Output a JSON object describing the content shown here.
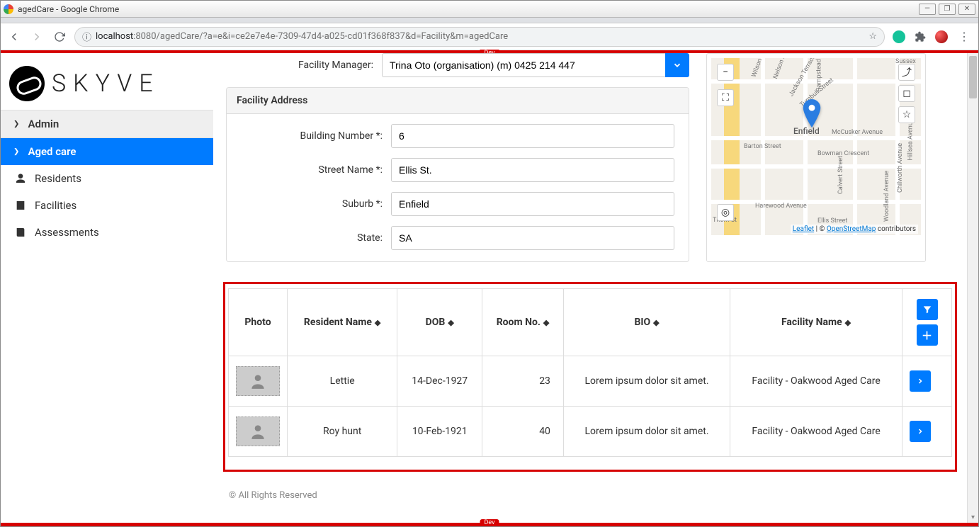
{
  "window": {
    "title": "agedCare - Google Chrome"
  },
  "url": {
    "host": "localhost",
    "port": ":8080",
    "path": "/agedCare/?a=e&i=ce2e7e4e-7309-47d4-a025-cd01f368f837&d=Facility&m=agedCare"
  },
  "dev_tag": "Dev",
  "logo_text": "SKYVE",
  "nav": {
    "admin": "Admin",
    "agedcare": "Aged care",
    "residents": "Residents",
    "facilities": "Facilities",
    "assessments": "Assessments"
  },
  "form": {
    "manager_label": "Facility Manager:",
    "manager_value": "Trina Oto (organisation) (m) 0425 214 447",
    "fieldset_title": "Facility Address",
    "building_label": "Building Number *:",
    "building_value": "6",
    "street_label": "Street Name *:",
    "street_value": "Ellis St.",
    "suburb_label": "Suburb *:",
    "suburb_value": "Enfield",
    "state_label": "State:",
    "state_value": "SA"
  },
  "map": {
    "place": "Enfield",
    "attribution_leaflet": "Leaflet",
    "attribution_osm": "OpenStreetMap",
    "attribution_suffix": " contributors",
    "roads": [
      "Wilson St",
      "Thorn St",
      "Hampstead Road",
      "Nelson St",
      "Jackson Terrace",
      "Turnbull Street",
      "Barton Street",
      "McCusker Avenue",
      "Bowman Crescent",
      "Harewood Avenue",
      "Hillsea Avenue",
      "Chilworth Avenue",
      "Woodland Avenue",
      "Ellis Street",
      "Calvert Street",
      "Sussex"
    ]
  },
  "table": {
    "headers": {
      "photo": "Photo",
      "name": "Resident Name",
      "dob": "DOB",
      "room": "Room No.",
      "bio": "BIO",
      "facility": "Facility Name"
    },
    "rows": [
      {
        "name": "Lettie",
        "dob": "14-Dec-1927",
        "room": "23",
        "bio": "Lorem ipsum dolor sit amet.",
        "facility": "Facility - Oakwood Aged Care"
      },
      {
        "name": "Roy hunt",
        "dob": "10-Feb-1921",
        "room": "40",
        "bio": "Lorem ipsum dolor sit amet.",
        "facility": "Facility - Oakwood Aged Care"
      }
    ]
  },
  "footer": "© All Rights Reserved"
}
